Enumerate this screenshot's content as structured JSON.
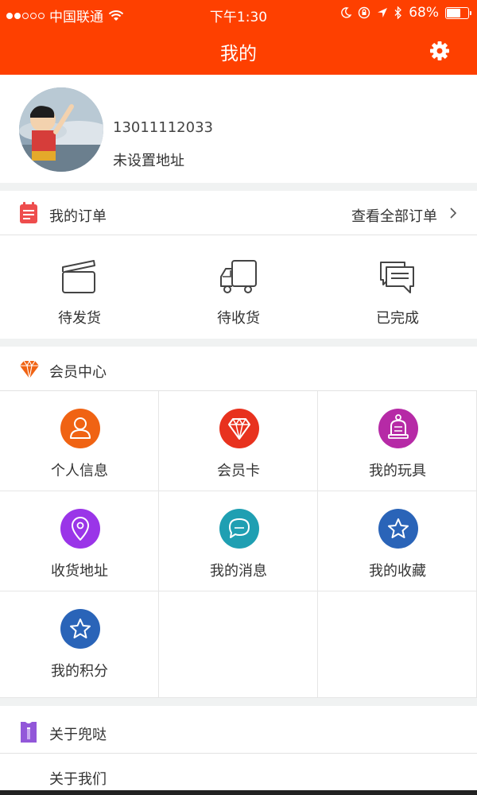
{
  "status_bar": {
    "carrier": "中国联通",
    "time": "下午1:30",
    "battery_percent": 68,
    "battery_label": "68%"
  },
  "header": {
    "title": "我的",
    "settings_icon": "gear-icon"
  },
  "profile": {
    "phone": "13011112033",
    "address": "未设置地址"
  },
  "orders": {
    "title": "我的订单",
    "view_all": "查看全部订单",
    "items": [
      {
        "label": "待发货",
        "icon": "clapperboard-icon"
      },
      {
        "label": "待收货",
        "icon": "truck-icon"
      },
      {
        "label": "已完成",
        "icon": "chat-bubbles-icon"
      }
    ]
  },
  "member": {
    "title": "会员中心",
    "items": [
      {
        "label": "个人信息",
        "icon": "person-icon",
        "color": "#f06313"
      },
      {
        "label": "会员卡",
        "icon": "diamond-icon",
        "color": "#e8321e"
      },
      {
        "label": "我的玩具",
        "icon": "bell-toy-icon",
        "color": "#b62aa6"
      },
      {
        "label": "收货地址",
        "icon": "location-pin-icon",
        "color": "#9a35e8"
      },
      {
        "label": "我的消息",
        "icon": "message-icon",
        "color": "#1f9fb2"
      },
      {
        "label": "我的收藏",
        "icon": "star-icon",
        "color": "#2a64b8"
      },
      {
        "label": "我的积分",
        "icon": "star-icon",
        "color": "#2a64b8"
      }
    ]
  },
  "about": {
    "title": "关于兜哒",
    "items": [
      {
        "label": "关于我们"
      }
    ]
  },
  "colors": {
    "brand": "#fe4000",
    "order_icon": "#ee4d4d",
    "member_icon": "#f06313",
    "about_icon": "#9257d9"
  }
}
